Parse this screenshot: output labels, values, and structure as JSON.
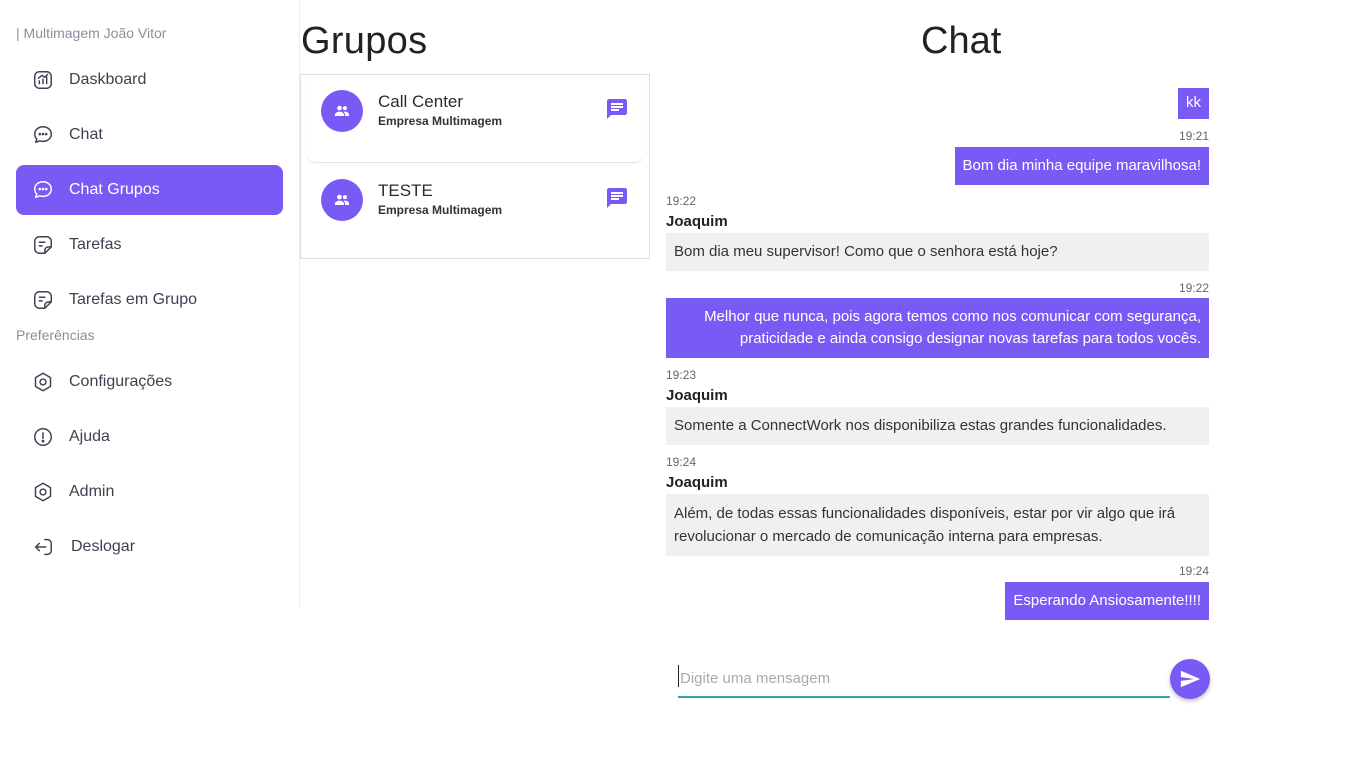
{
  "sidebar": {
    "brand": "| Multimagem João Vitor",
    "section_label": "Preferências",
    "items": [
      {
        "label": "Daskboard",
        "icon": "dashboard-icon"
      },
      {
        "label": "Chat",
        "icon": "chat-icon"
      },
      {
        "label": "Chat Grupos",
        "icon": "chat-groups-icon",
        "active": true
      },
      {
        "label": "Tarefas",
        "icon": "tasks-icon"
      },
      {
        "label": "Tarefas em Grupo",
        "icon": "group-tasks-icon"
      },
      {
        "label": "Configurações",
        "icon": "settings-icon"
      },
      {
        "label": "Ajuda",
        "icon": "help-icon"
      },
      {
        "label": "Admin",
        "icon": "admin-icon"
      },
      {
        "label": "Deslogar",
        "icon": "logout-icon"
      }
    ]
  },
  "groups": {
    "title": "Grupos",
    "list": [
      {
        "name": "Call Center",
        "company": "Empresa Multimagem"
      },
      {
        "name": "TESTE",
        "company": "Empresa Multimagem"
      }
    ]
  },
  "chat": {
    "title": "Chat",
    "messages": [
      {
        "dir": "out",
        "text": "kk"
      },
      {
        "time": "19:21",
        "dir": "out",
        "text": "Bom dia minha equipe maravilhosa!"
      },
      {
        "time": "19:22",
        "dir": "in",
        "sender": "Joaquim",
        "text": "Bom dia meu supervisor! Como que o senhora está hoje?"
      },
      {
        "time": "19:22",
        "dir": "out",
        "line1": "Melhor que nunca, pois agora temos como nos comunicar com segurança,",
        "line2": "praticidade e ainda consigo designar novas tarefas para todos vocês."
      },
      {
        "time": "19:23",
        "dir": "in",
        "sender": "Joaquim",
        "text": "Somente a ConnectWork nos disponibiliza estas grandes funcionalidades."
      },
      {
        "time": "19:24",
        "dir": "in",
        "sender": "Joaquim",
        "line1": "Além, de todas essas funcionalidades disponíveis, estar por vir algo que irá",
        "line2": "revolucionar o mercado de comunicação interna para empresas."
      },
      {
        "time": "19:24",
        "dir": "out",
        "text": "Esperando Ansiosamente!!!!"
      }
    ],
    "input_placeholder": "Digite uma mensagem",
    "input_value": ""
  },
  "colors": {
    "accent": "#7a5af5",
    "input_underline": "#3aa3a3",
    "incoming_bubble": "#f0f0f0"
  }
}
